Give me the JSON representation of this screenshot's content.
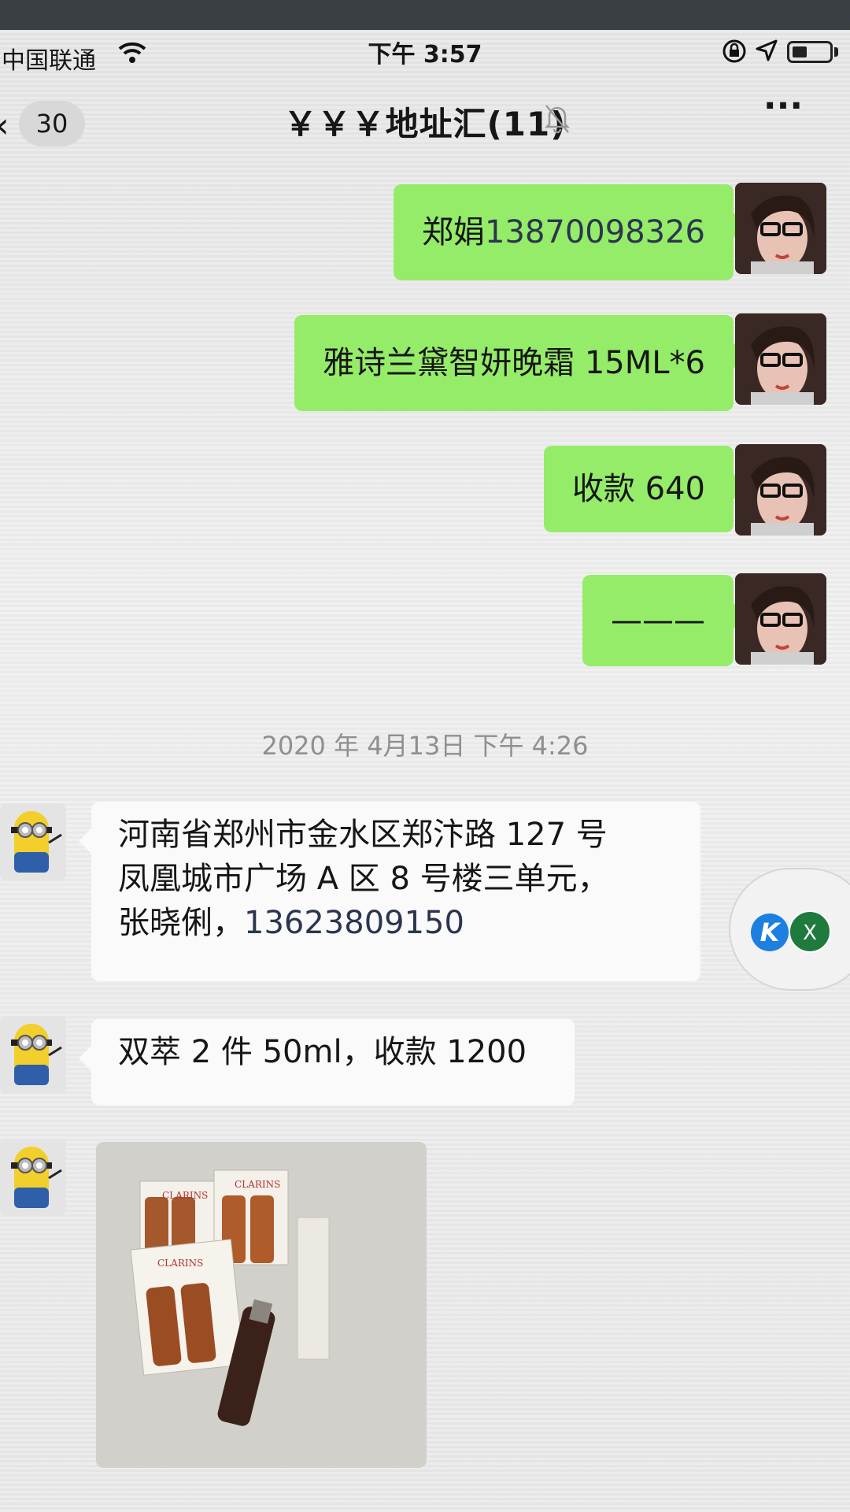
{
  "status_bar": {
    "carrier": "中国联通",
    "time": "下午 3:57"
  },
  "nav": {
    "back_count": "30",
    "title": "￥￥￥地址汇(11)"
  },
  "messages": [
    {
      "dir": "out",
      "text_a": "郑娟",
      "text_b": "13870098326"
    },
    {
      "dir": "out",
      "text": "雅诗兰黛智妍晚霜 15ML*6"
    },
    {
      "dir": "out",
      "text": "收款 640"
    },
    {
      "dir": "out",
      "text": "———"
    },
    {
      "dir": "in",
      "line1": "河南省郑州市金水区郑汴路 127 号",
      "line2": "凤凰城市广场 A 区 8 号楼三单元，",
      "line3_a": "张晓俐，",
      "line3_b": "13623809150"
    },
    {
      "dir": "in",
      "text": "双萃 2 件 50ml，收款 1200"
    },
    {
      "dir": "in",
      "type": "image",
      "product_text": "CLARINS"
    }
  ],
  "timestamp": "2020 年 4月13日 下午 4:26",
  "float_widget": {
    "k_label": "K",
    "x_label": "X"
  },
  "colors": {
    "out_bubble": "#95ec69",
    "in_bubble": "#fafafa",
    "background": "#ececec"
  }
}
